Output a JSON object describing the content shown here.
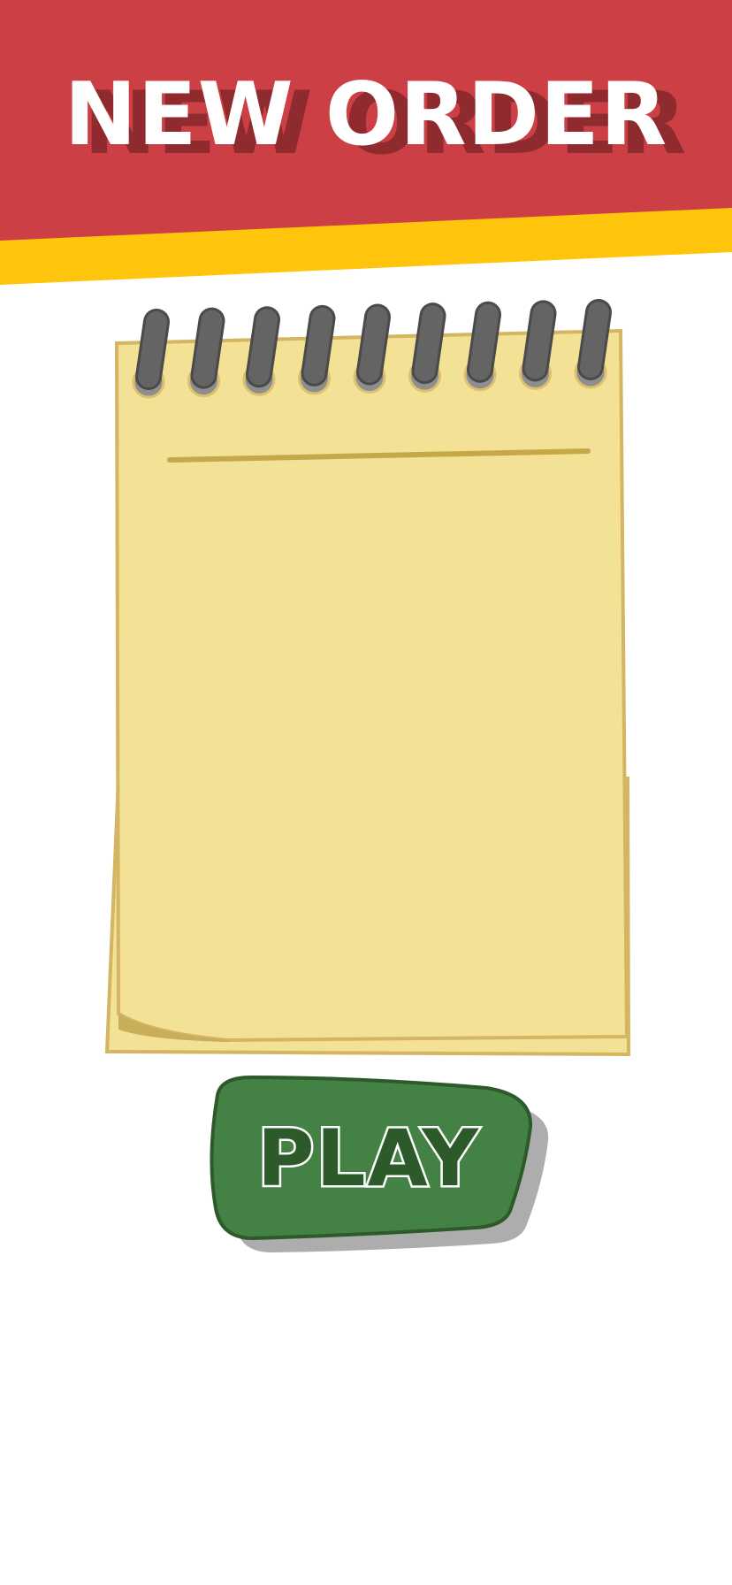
{
  "header": {
    "title": "NEW ORDER"
  },
  "play_button": {
    "label": "PLAY"
  },
  "notepad": {
    "ring_count": 9,
    "lines": []
  },
  "colors": {
    "banner_red": "#cc4045",
    "banner_shadow": "#8f2a2e",
    "stripe_yellow": "#fec50c",
    "paper": "#f3e196",
    "paper_border": "#d4b562",
    "ring": "#646464",
    "button_green": "#448144",
    "button_dark_green": "#2d5a2b",
    "button_shadow": "#adadad"
  }
}
